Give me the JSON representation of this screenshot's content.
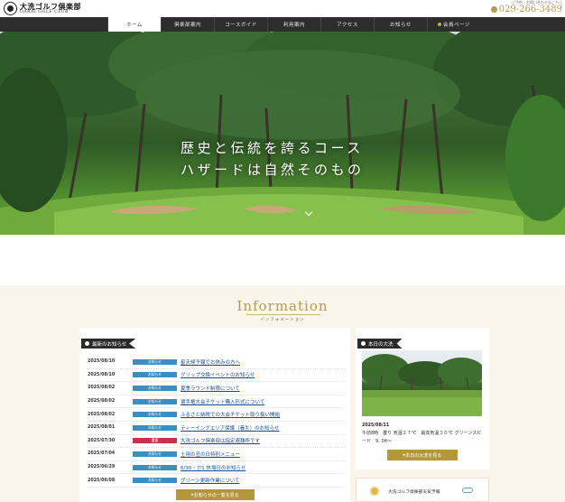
{
  "header": {
    "logo_jp": "大洗ゴルフ倶楽部",
    "logo_en": "OARAI GOLF CLUB",
    "contact_note": "ご予約・お問い合わせはこちら",
    "phone": "029-266-3489"
  },
  "nav": {
    "items": [
      {
        "label": "ホーム",
        "active": true
      },
      {
        "label": "倶楽部案内"
      },
      {
        "label": "コースガイド"
      },
      {
        "label": "利用案内"
      },
      {
        "label": "アクセス"
      },
      {
        "label": "お知らせ"
      },
      {
        "label": "会員ページ"
      }
    ]
  },
  "hero": {
    "line1": "歴史と伝統を誇るコース",
    "line2": "ハザードは自然そのもの"
  },
  "info": {
    "title": "Information",
    "subtitle": "インフォメーション"
  },
  "news": {
    "heading": "最新のお知らせ",
    "more_label": "お知らせの一覧を見る",
    "items": [
      {
        "date": "2025/08/10",
        "badge": "お知らせ",
        "title": "星天候予報でお休みの方へ"
      },
      {
        "date": "2025/08/10",
        "badge": "お知らせ",
        "title": "グリップ交換イベントのお知らせ"
      },
      {
        "date": "2025/08/02",
        "badge": "お知らせ",
        "title": "夏季ラウンド制限について"
      },
      {
        "date": "2025/08/02",
        "badge": "お知らせ",
        "title": "選手権大会チケット購入形式について"
      },
      {
        "date": "2025/08/02",
        "badge": "お知らせ",
        "title": "ふるさと納税での大会チケット取り扱い開始"
      },
      {
        "date": "2025/08/01",
        "badge": "お知らせ",
        "title": "ティーイングエリア保護（養生）のお知らせ"
      },
      {
        "date": "2025/07/30",
        "badge": "重要",
        "title": "大洗ゴルフ倶楽部は指定避難所です",
        "important": true
      },
      {
        "date": "2025/07/04",
        "badge": "お知らせ",
        "title": "土用の丑の日特別メニュー"
      },
      {
        "date": "2025/06/29",
        "badge": "お知らせ",
        "title": "6/30・7/1 休場日のお知らせ"
      },
      {
        "date": "2025/06/08",
        "badge": "お知らせ",
        "title": "グリーン更新作業について"
      }
    ]
  },
  "today": {
    "heading": "本日の大洗",
    "date": "2025/08/11",
    "weather": "午前8時　曇り 気温２７℃　最高気温３０℃ グリーンスピード　9. 0ft～",
    "button_label": "本日の大洗を見る"
  },
  "forecast": {
    "label": "大洗ゴルフ倶楽部天気予報"
  },
  "colors": {
    "gold": "#b5973b",
    "nav_bg": "#2d2d2d",
    "badge_blue": "#3c8ec0",
    "badge_red": "#c5344f",
    "cream": "#faf5ea"
  }
}
